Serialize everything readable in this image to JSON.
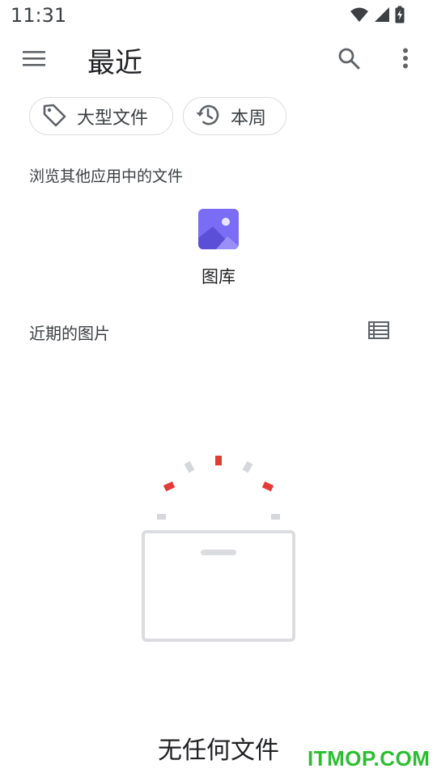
{
  "status_bar": {
    "time": "11:31",
    "icons": [
      "wifi-icon",
      "cell-signal-icon",
      "battery-charging-icon"
    ]
  },
  "app_bar": {
    "title": "最近",
    "menu_icon": "hamburger-menu-icon",
    "search_icon": "search-icon",
    "overflow_icon": "more-vert-icon"
  },
  "chips": [
    {
      "label": "大型文件",
      "icon": "label-tag-icon"
    },
    {
      "label": "本周",
      "icon": "history-icon"
    }
  ],
  "browse_section": {
    "header": "浏览其他应用中的文件",
    "apps": [
      {
        "label": "图库",
        "icon": "gallery-icon"
      }
    ]
  },
  "recent_section": {
    "header": "近期的图片",
    "view_toggle_icon": "list-view-icon"
  },
  "empty_state": {
    "message": "无任何文件"
  },
  "watermark": "ITMOP.COM",
  "colors": {
    "accent_red": "#e53935",
    "chip_border": "#dadce0",
    "gallery_purple": "#7b6cf6",
    "watermark_green": "#2bbf2f"
  }
}
